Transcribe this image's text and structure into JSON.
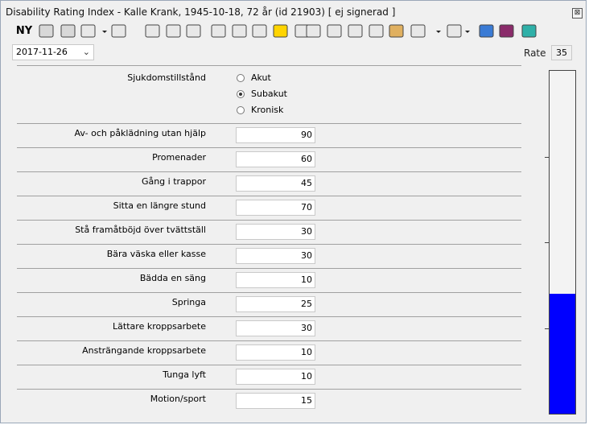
{
  "window": {
    "title": "Disability Rating Index - Kalle Krank, 1945-10-18, 72 år (id 21903) [ ej signerad ]",
    "close_glyph": "⊠"
  },
  "toolbar": {
    "ny_label": "NY",
    "icons": [
      "disabled-circle-icon",
      "group-icon",
      "save-icon",
      "dropdown-arrow",
      "journal-icon",
      "briefcase-icon",
      "edit-icon",
      "visit-icon",
      "p-icon",
      "document-icon",
      "numbers-icon",
      "m-icon",
      "pen-icon",
      "chat-icon",
      "id-icon",
      "card-icon",
      "b-icon",
      "map-icon",
      "tools-icon",
      "dropdown-arrow",
      "gears-icon",
      "dropdown-arrow",
      "keyboard-icon",
      "book-icon",
      "exit-icon"
    ]
  },
  "date": {
    "value": "2017-11-26"
  },
  "rate": {
    "label": "Rate",
    "value": "35"
  },
  "condition": {
    "label": "Sjukdomstillstånd",
    "options": [
      "Akut",
      "Subakut",
      "Kronisk"
    ],
    "selected": "Subakut"
  },
  "items": [
    {
      "label": "Av- och påklädning utan hjälp",
      "value": "90"
    },
    {
      "label": "Promenader",
      "value": "60"
    },
    {
      "label": "Gång i trappor",
      "value": "45"
    },
    {
      "label": "Sitta en längre stund",
      "value": "70"
    },
    {
      "label": "Stå framåtböjd över tvättställ",
      "value": "30"
    },
    {
      "label": "Bära väska eller kasse",
      "value": "30"
    },
    {
      "label": "Bädda en säng",
      "value": "10"
    },
    {
      "label": "Springa",
      "value": "25"
    },
    {
      "label": "Lättare kroppsarbete",
      "value": "30"
    },
    {
      "label": "Ansträngande kroppsarbete",
      "value": "10"
    },
    {
      "label": "Tunga lyft",
      "value": "10"
    },
    {
      "label": "Motion/sport",
      "value": "15"
    }
  ],
  "gauge": {
    "level_percent": 35,
    "fill_color": "#0000ff"
  }
}
